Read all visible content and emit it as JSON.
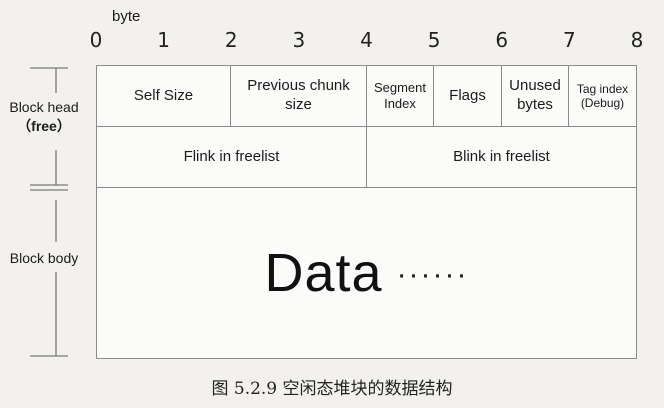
{
  "byte_unit": "byte",
  "ticks": [
    "0",
    "1",
    "2",
    "3",
    "4",
    "5",
    "6",
    "7",
    "8"
  ],
  "side_labels": {
    "block_head": "Block head",
    "block_head_note": "（free）",
    "block_body": "Block body"
  },
  "row1": [
    {
      "label": "Self Size"
    },
    {
      "label": "Previous chunk size"
    },
    {
      "label": "Segment Index"
    },
    {
      "label": "Flags"
    },
    {
      "label": "Unused bytes"
    },
    {
      "label": "Tag index (Debug)"
    }
  ],
  "row2": {
    "flink": "Flink in freelist",
    "blink": "Blink in freelist"
  },
  "body": {
    "data": "Data",
    "ellipsis": "······"
  },
  "caption": "图 5.2.9   空闲态堆块的数据结构"
}
